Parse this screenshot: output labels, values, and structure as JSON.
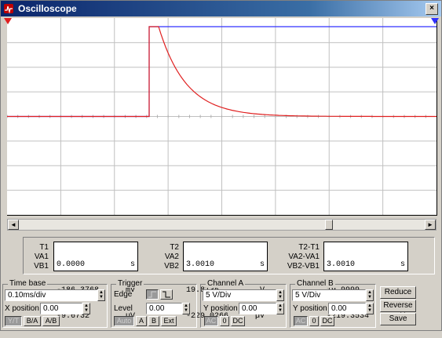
{
  "window": {
    "title": "Oscilloscope",
    "close_glyph": "×"
  },
  "screen": {
    "bg_color": "#ffffff",
    "grid_color": "#c0c0c0",
    "trace_a_color": "#e02020",
    "trace_b_color": "#3030ff",
    "marker_t1_label": "1",
    "marker_t2_label": "2"
  },
  "scroll": {
    "left_glyph": "◄",
    "right_glyph": "►"
  },
  "readouts": {
    "t1": {
      "labels": [
        "T1",
        "VA1",
        "VB1"
      ],
      "values": [
        "0.0000",
        "-186.3768",
        "-9.6732"
      ],
      "units": [
        "s",
        "mV",
        "µV"
      ]
    },
    "t2": {
      "labels": [
        "T2",
        "VA2",
        "VB2"
      ],
      "values": [
        "3.0010",
        "19.8135",
        "-229.0266"
      ],
      "units": [
        "s",
        "V",
        "µV"
      ]
    },
    "dt": {
      "labels": [
        "T2-T1",
        "VA2-VA1",
        "VB2-VB1"
      ],
      "values": [
        "3.0010",
        "19.9999",
        "-219.3534"
      ],
      "units": [
        "s",
        "V",
        "µV"
      ]
    }
  },
  "timebase": {
    "title": "Time base",
    "value": "0.10ms/div",
    "xpos_label": "X position",
    "xpos_value": "0.00",
    "modes": [
      "Y/T",
      "B/A",
      "A/B"
    ]
  },
  "trigger": {
    "title": "Trigger",
    "edge_label": "Edge",
    "level_label": "Level",
    "level_value": "0.00",
    "buttons": [
      "Auto",
      "A",
      "B",
      "Ext"
    ]
  },
  "channel_a": {
    "title": "Channel A",
    "value": "5 V/Div",
    "ypos_label": "Y position",
    "ypos_value": "0.00",
    "coupling": [
      "AC",
      "0",
      "DC"
    ]
  },
  "channel_b": {
    "title": "Channel B",
    "value": "5 V/Div",
    "ypos_label": "Y position",
    "ypos_value": "0.00",
    "coupling": [
      "AC",
      "0",
      "DC"
    ]
  },
  "actions": {
    "reduce": "Reduce",
    "reverse": "Reverse",
    "save": "Save"
  }
}
